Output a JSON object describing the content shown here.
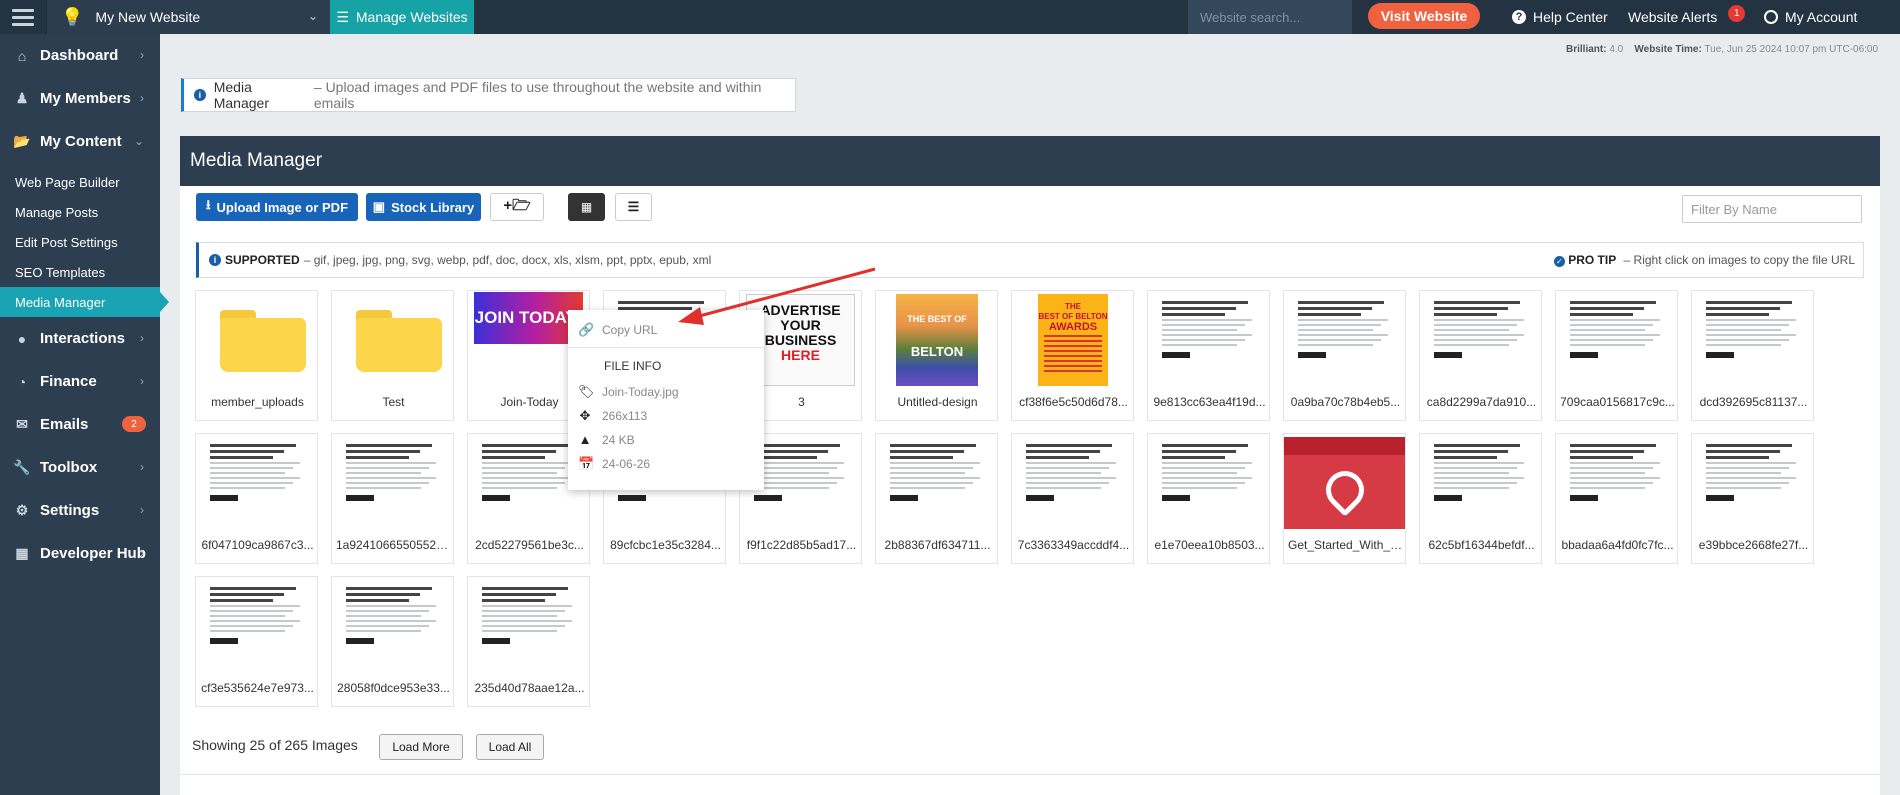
{
  "topbar": {
    "site_name": "My New Website",
    "manage_label": "Manage Websites",
    "search_placeholder": "Website search...",
    "visit_label": "Visit Website",
    "help_label": "Help Center",
    "alerts_label": "Website Alerts",
    "alerts_count": "1",
    "account_label": "My Account"
  },
  "sidebar": {
    "items": [
      {
        "label": "Dashboard",
        "icon": "home-icon"
      },
      {
        "label": "My Members",
        "icon": "users-icon"
      },
      {
        "label": "My Content",
        "icon": "folder-open-icon"
      }
    ],
    "sub_items": [
      "Web Page Builder",
      "Manage Posts",
      "Edit Post Settings",
      "SEO Templates",
      "Media Manager"
    ],
    "items2": [
      {
        "label": "Interactions",
        "icon": "comments-icon"
      },
      {
        "label": "Finance",
        "icon": "pie-chart-icon"
      },
      {
        "label": "Emails",
        "icon": "envelope-icon",
        "badge": "2"
      },
      {
        "label": "Toolbox",
        "icon": "wrench-icon"
      },
      {
        "label": "Settings",
        "icon": "gear-icon"
      },
      {
        "label": "Developer Hub",
        "icon": "grid-icon"
      }
    ]
  },
  "meta": {
    "brilliant_label": "Brilliant:",
    "brilliant_value": "4.0",
    "time_label": "Website Time:",
    "time_value": "Tue, Jun 25 2024 10:07 pm UTC-06:00"
  },
  "banner": {
    "title": "Media Manager",
    "text": "– Upload images and PDF files to use throughout the website and within emails"
  },
  "panel": {
    "title": "Media Manager",
    "upload_label": "Upload Image or PDF",
    "stock_label": "Stock Library",
    "filter_placeholder": "Filter By Name",
    "supported_label": "SUPPORTED",
    "supported_text": "– gif, jpeg, jpg, png, svg, webp, pdf, doc, docx, xls, xlsm, ppt, pptx, epub, xml",
    "protip_label": "PRO TIP",
    "protip_text": "– Right click on images to copy the file URL"
  },
  "tiles": [
    {
      "name": "member_uploads",
      "type": "folder"
    },
    {
      "name": "Test",
      "type": "folder"
    },
    {
      "name": "Join-Today",
      "type": "join"
    },
    {
      "name": "",
      "type": "doc"
    },
    {
      "name": "3",
      "type": "ad"
    },
    {
      "name": "Untitled-design",
      "type": "belton"
    },
    {
      "name": "cf38f6e5c50d6d78...",
      "type": "awards"
    },
    {
      "name": "9e813cc63ea4f19d...",
      "type": "doc"
    },
    {
      "name": "0a9ba70c78b4eb5...",
      "type": "doc"
    },
    {
      "name": "ca8d2299a7da910...",
      "type": "doc"
    },
    {
      "name": "709caa0156817c9c...",
      "type": "doc"
    },
    {
      "name": "dcd392695c81137...",
      "type": "doc"
    },
    {
      "name": "6f047109ca9867c3...",
      "type": "doc"
    },
    {
      "name": "1a92410665505524...",
      "type": "doc"
    },
    {
      "name": "2cd52279561be3c...",
      "type": "doc"
    },
    {
      "name": "89cfcbc1e35c3284...",
      "type": "doc"
    },
    {
      "name": "f9f1c22d85b5ad17...",
      "type": "doc"
    },
    {
      "name": "2b88367df634711...",
      "type": "doc"
    },
    {
      "name": "7c3363349accddf4...",
      "type": "doc"
    },
    {
      "name": "e1e70eea10b8503...",
      "type": "doc"
    },
    {
      "name": "Get_Started_With_S...",
      "type": "pdf"
    },
    {
      "name": "62c5bf16344befdf...",
      "type": "doc"
    },
    {
      "name": "bbadaa6a4fd0fc7fc...",
      "type": "doc"
    },
    {
      "name": "e39bbce2668fe27f...",
      "type": "doc"
    },
    {
      "name": "cf3e535624e7e973...",
      "type": "doc"
    },
    {
      "name": "28058f0dce953e33...",
      "type": "doc"
    },
    {
      "name": "235d40d78aae12a...",
      "type": "doc"
    }
  ],
  "thumb_text": {
    "join": "JOIN TODAY!",
    "ad": [
      "ADVERTISE",
      "YOUR",
      "BUSINESS",
      "HERE"
    ],
    "belton": [
      "THE BEST OF",
      "BELTON"
    ],
    "awards": [
      "THE",
      "BEST OF BELTON",
      "AWARDS"
    ]
  },
  "context_menu": {
    "copy_label": "Copy URL",
    "file_info_label": "FILE INFO",
    "filename": "Join-Today.jpg",
    "dimensions": "266x113",
    "size": "24 KB",
    "date": "24-06-26"
  },
  "footer": {
    "showing_text": "Showing 25 of 265 Images",
    "load_more_label": "Load More",
    "load_all_label": "Load All"
  },
  "colors": {
    "topbar": "#233342",
    "sidebar": "#2c3e50",
    "accent_teal": "#1aa3b2",
    "primary_blue": "#1764b8",
    "visit_orange": "#f0623f",
    "arrow_red": "#e0302c"
  }
}
